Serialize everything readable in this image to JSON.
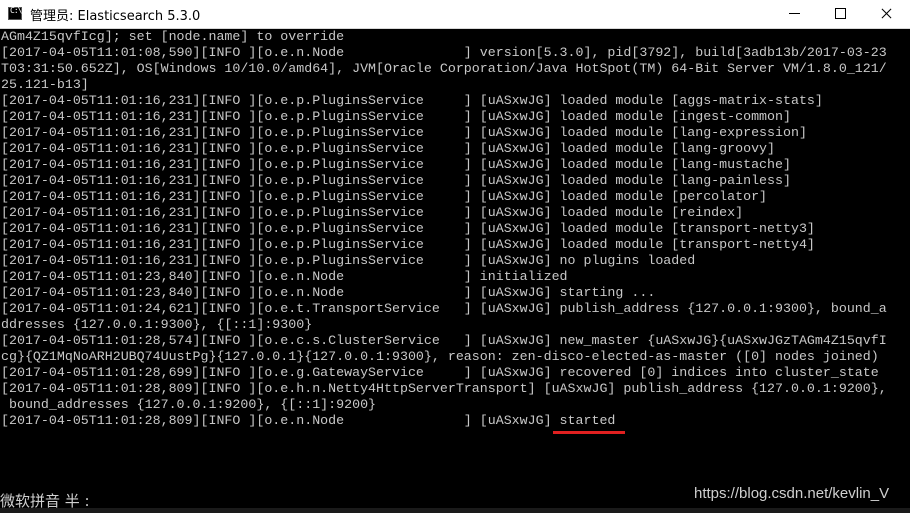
{
  "window": {
    "icon_text": "C:\\",
    "title": "管理员:  Elasticsearch 5.3.0"
  },
  "console": {
    "lines": [
      "AGm4Z15qvfIcg]; set [node.name] to override",
      "[2017-04-05T11:01:08,590][INFO ][o.e.n.Node               ] version[5.3.0], pid[3792], build[3adb13b/2017-03-23",
      "T03:31:50.652Z], OS[Windows 10/10.0/amd64], JVM[Oracle Corporation/Java HotSpot(TM) 64-Bit Server VM/1.8.0_121/",
      "25.121-b13]",
      "[2017-04-05T11:01:16,231][INFO ][o.e.p.PluginsService     ] [uASxwJG] loaded module [aggs-matrix-stats]",
      "[2017-04-05T11:01:16,231][INFO ][o.e.p.PluginsService     ] [uASxwJG] loaded module [ingest-common]",
      "[2017-04-05T11:01:16,231][INFO ][o.e.p.PluginsService     ] [uASxwJG] loaded module [lang-expression]",
      "[2017-04-05T11:01:16,231][INFO ][o.e.p.PluginsService     ] [uASxwJG] loaded module [lang-groovy]",
      "[2017-04-05T11:01:16,231][INFO ][o.e.p.PluginsService     ] [uASxwJG] loaded module [lang-mustache]",
      "[2017-04-05T11:01:16,231][INFO ][o.e.p.PluginsService     ] [uASxwJG] loaded module [lang-painless]",
      "[2017-04-05T11:01:16,231][INFO ][o.e.p.PluginsService     ] [uASxwJG] loaded module [percolator]",
      "[2017-04-05T11:01:16,231][INFO ][o.e.p.PluginsService     ] [uASxwJG] loaded module [reindex]",
      "[2017-04-05T11:01:16,231][INFO ][o.e.p.PluginsService     ] [uASxwJG] loaded module [transport-netty3]",
      "[2017-04-05T11:01:16,231][INFO ][o.e.p.PluginsService     ] [uASxwJG] loaded module [transport-netty4]",
      "[2017-04-05T11:01:16,231][INFO ][o.e.p.PluginsService     ] [uASxwJG] no plugins loaded",
      "[2017-04-05T11:01:23,840][INFO ][o.e.n.Node               ] initialized",
      "[2017-04-05T11:01:23,840][INFO ][o.e.n.Node               ] [uASxwJG] starting ...",
      "[2017-04-05T11:01:24,621][INFO ][o.e.t.TransportService   ] [uASxwJG] publish_address {127.0.0.1:9300}, bound_a",
      "ddresses {127.0.0.1:9300}, {[::1]:9300}",
      "[2017-04-05T11:01:28,574][INFO ][o.e.c.s.ClusterService   ] [uASxwJG] new_master {uASxwJG}{uASxwJGzTAGm4Z15qvfI",
      "cg}{QZ1MqNoARH2UBQ74UustPg}{127.0.0.1}{127.0.0.1:9300}, reason: zen-disco-elected-as-master ([0] nodes joined)",
      "[2017-04-05T11:01:28,699][INFO ][o.e.g.GatewayService     ] [uASxwJG] recovered [0] indices into cluster_state",
      "[2017-04-05T11:01:28,809][INFO ][o.e.h.n.Netty4HttpServerTransport] [uASxwJG] publish_address {127.0.0.1:9200},",
      " bound_addresses {127.0.0.1:9200}, {[::1]:9200}",
      "[2017-04-05T11:01:28,809][INFO ][o.e.n.Node               ] [uASxwJG] started"
    ]
  },
  "ime_status": "微软拼音 半 :",
  "watermark": "https://blog.csdn.net/kevlin_V",
  "colors": {
    "console_bg": "#000000",
    "console_text": "#c8c8c8",
    "highlight_underline": "#e02020"
  }
}
